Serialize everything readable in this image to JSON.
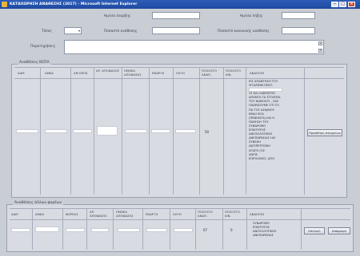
{
  "window": {
    "title": "ΚΑΤΑΧΩΡΗΣΗ ΑΝΑΘΕΣΗΣ (2017) - Microsoft Internet Explorer"
  },
  "form": {
    "date_label": "Ημ/νία έναρξης",
    "end_date_label": "Ημ/νία λήξης",
    "type_label": "Τύπος",
    "amount_label": "Ποσοστό ανάθεσης",
    "percent_label": "Ποσοστό κανονικής ανάθεσης",
    "comments_label": "Παρατηρήσεις"
  },
  "kepa_section": {
    "title": "Αναθέσεις ΚΕΠΑ",
    "columns": [
      "ΑΔΜ",
      "ΑΜΚΑ",
      "ΑΜ ΚΕΠΑ",
      "ΑΡ. ΑΠΟΦΑΣΗΣ",
      "ΗΜ/ΝΙΑ ΑΠΟΦΑΣΗΣ",
      "ΕΝΑΡΞΗ",
      "ΛΗΞΗ",
      "ΠΟΣΟΣΤΟ ΑΝΑΠ.",
      "ΠΟΣΟΣΤΟ ΚΙΝ.",
      "ΑΝΑΛΥΣΗ"
    ],
    "row": {
      "percent": "50",
      "analysis_lines": [
        "ΕΙΣ ΑΠΑΝΤΗΣΗ ΤΟΥ",
        "ΥΠ'ΑΡΙΘΜ.ΠΡΩΤ.",
        "",
        "ΥΣ ΚΑΙ ΛΑΒΟΝΤΕΣ",
        "ΑΠΑΝΤΑ ΤΑ ΣΤΟΙΧΕΙΑ",
        "ΤΟΥ ΦΑΚΕΛΟΥ , ΣΑΣ",
        "ΓΝΩΡΙΖΟΥΜΕ ΟΤΙ ΤΟ",
        "ΠΑ ΤΟΥ ΑΣΦ/ΝΟΥ",
        "ΕΙΝΑΙ 50%",
        "(ΠΕΝΗΝΤΑ) ΚΑΙ Η",
        "ΠΑΘΗΣΗ ΤΟΥ",
        "ΣΥΝΔΡΟΜΟ",
        "ΕΠΙΚΤΗΤΗΣ",
        "ΑΝΟΣΟΛΟΓΙΚΗΣ",
        "ΑΝΕΠΑΡΚΕΙΑΣ ΗΙV",
        "ΣΥΝΕΧΗ",
        "ΑΝΤΙΡΕΤΡΟΪΚΗ",
        "ΑΓΩΓΗ (ΟΣ",
        "ΧΩΡΙΣ",
        "ΕΠΙΠΛΟΚΕΣ, ΑΠΟ"
      ],
      "button": "Προσθήκη στοιχείων"
    }
  },
  "other_section": {
    "title": "Αναθέσεις άλλων φορέων",
    "columns": [
      "ΑΔΜ",
      "ΑΜΚΑ",
      "ΦΟΡΕΑΣ",
      "ΑΡ. ΑΠΟΦΑΣΗΣ",
      "ΗΜ/ΝΙΑ ΑΠΟΦΑΣΗΣ",
      "ΕΝΑΡΞΗ",
      "ΛΗΞΗ",
      "ΠΟΣΟΣΤΟ ΑΝΑΠ.",
      "ΠΟΣΟΣΤΟ ΚΙΝ.",
      "ΑΝΑΛΥΣΗ"
    ],
    "row": {
      "percent": "67",
      "kin": "0",
      "analysis_lines": [
        "ΣΥΝΔΡΟΜΟ",
        "ΕΠΙΚΤΗΤΗΣ",
        "ΑΝΟΣΟΛΟΓΙΚΗΣ",
        "ΑΝΕΠΑΡΚΕΙΑΣ"
      ],
      "select_button": "Επιλογή",
      "other_button": "Απόρριψη"
    }
  },
  "colors": {
    "titlebar": "#2d5db8",
    "background": "#c9cdd4",
    "close": "#c94a36"
  },
  "icons": {
    "app": "ie-icon",
    "minimize": "minimize-icon",
    "maximize": "maximize-icon",
    "close": "close-icon"
  }
}
